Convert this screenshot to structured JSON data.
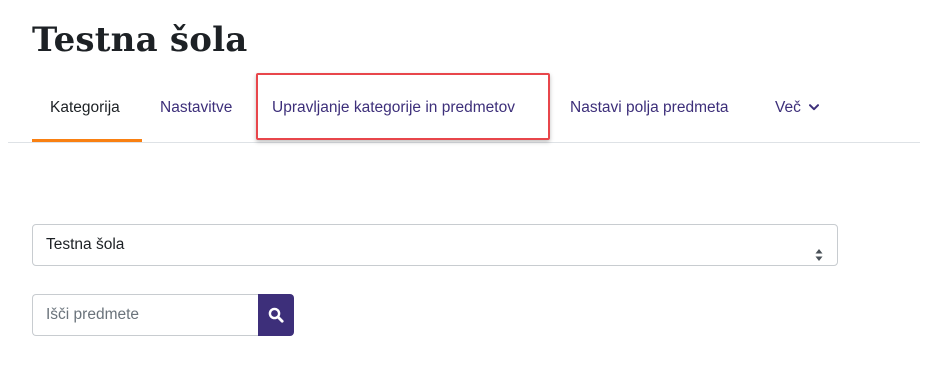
{
  "header": {
    "title": "Testna šola"
  },
  "nav": {
    "tabs": [
      {
        "label": "Kategorija",
        "active": true
      },
      {
        "label": "Nastavitve",
        "active": false
      },
      {
        "label": "Upravljanje kategorije in predmetov",
        "active": false,
        "highlighted": true
      },
      {
        "label": "Nastavi polja predmeta",
        "active": false
      },
      {
        "label": "Več",
        "active": false,
        "icon": "chevron-down-icon"
      }
    ]
  },
  "category_select": {
    "selected": "Testna šola",
    "icon": "select-arrows-icon"
  },
  "search": {
    "placeholder": "Išči predmete",
    "value": "",
    "button_icon": "search-icon"
  },
  "colors": {
    "brand_purple": "#3d2f7a",
    "active_underline": "#f98012",
    "highlight_border": "#e8464b"
  }
}
